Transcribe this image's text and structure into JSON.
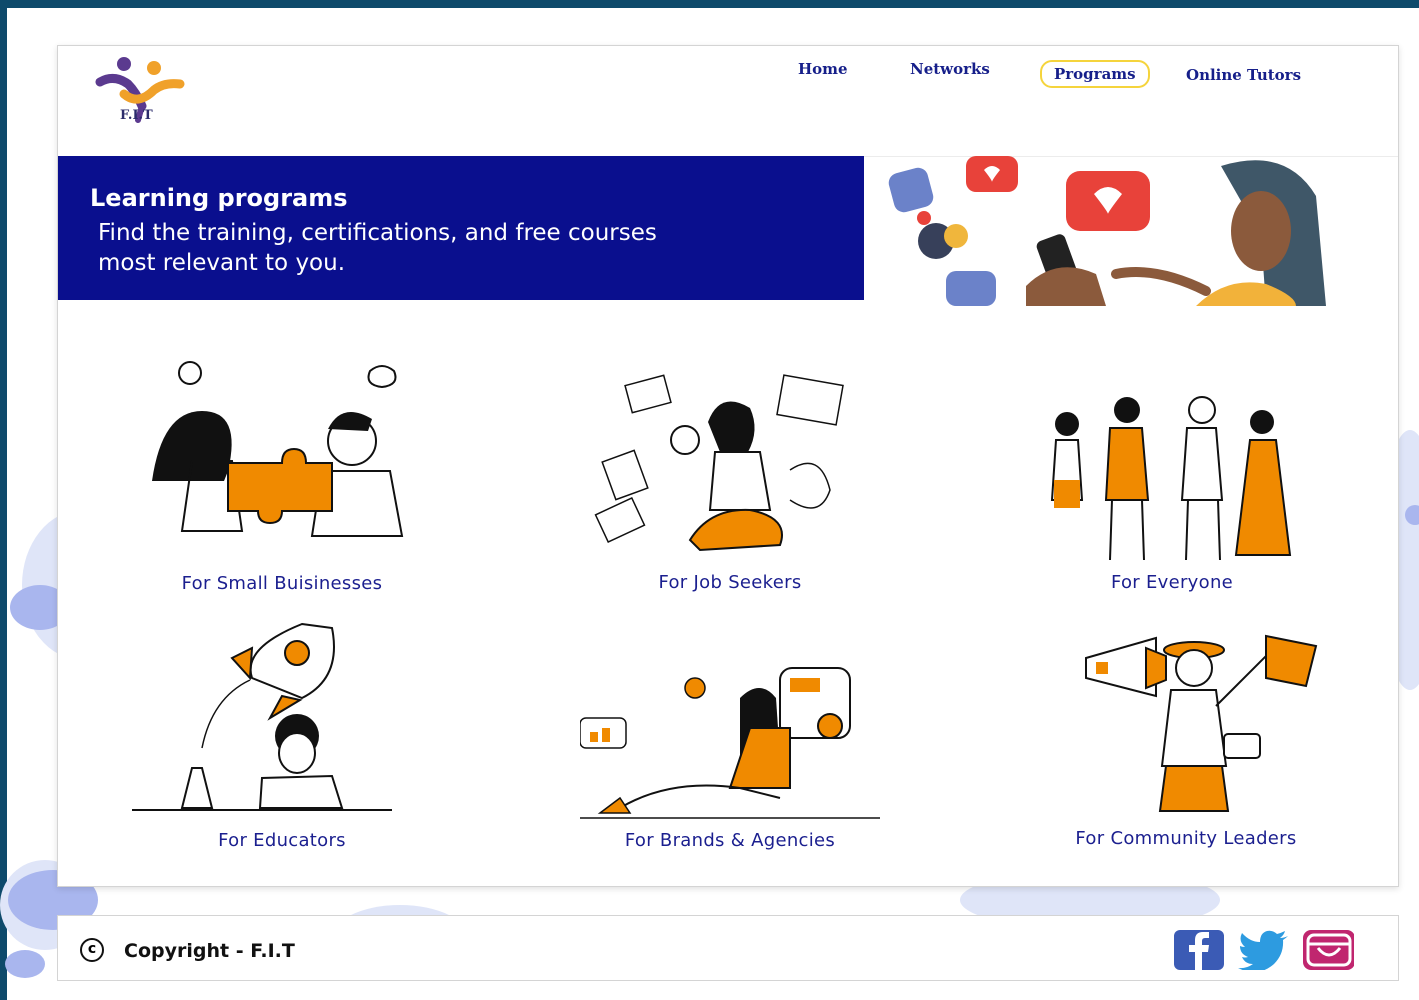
{
  "brand": {
    "name": "F.I.T"
  },
  "nav": {
    "items": [
      {
        "label": "Home"
      },
      {
        "label": "Networks"
      },
      {
        "label": "Programs",
        "active": true
      },
      {
        "label": "Online Tutors"
      }
    ]
  },
  "hero": {
    "title": "Learning programs",
    "subtitle": "Find the training, certifications, and free courses most relevant to you."
  },
  "programs": [
    {
      "label": "For Small Buisinesses"
    },
    {
      "label": "For Job Seekers"
    },
    {
      "label": "For Everyone"
    },
    {
      "label": "For Educators"
    },
    {
      "label": "For Brands & Agencies"
    },
    {
      "label": "For Community Leaders"
    }
  ],
  "footer": {
    "copyright_symbol": "c",
    "copyright": "Copyright - F.I.T",
    "social": [
      "facebook-icon",
      "twitter-icon",
      "instagram-icon"
    ]
  },
  "colors": {
    "navy": "#0a0f8e",
    "accent_orange": "#f08a00",
    "active_outline": "#f5d43c",
    "frame": "#0e4a6b"
  }
}
